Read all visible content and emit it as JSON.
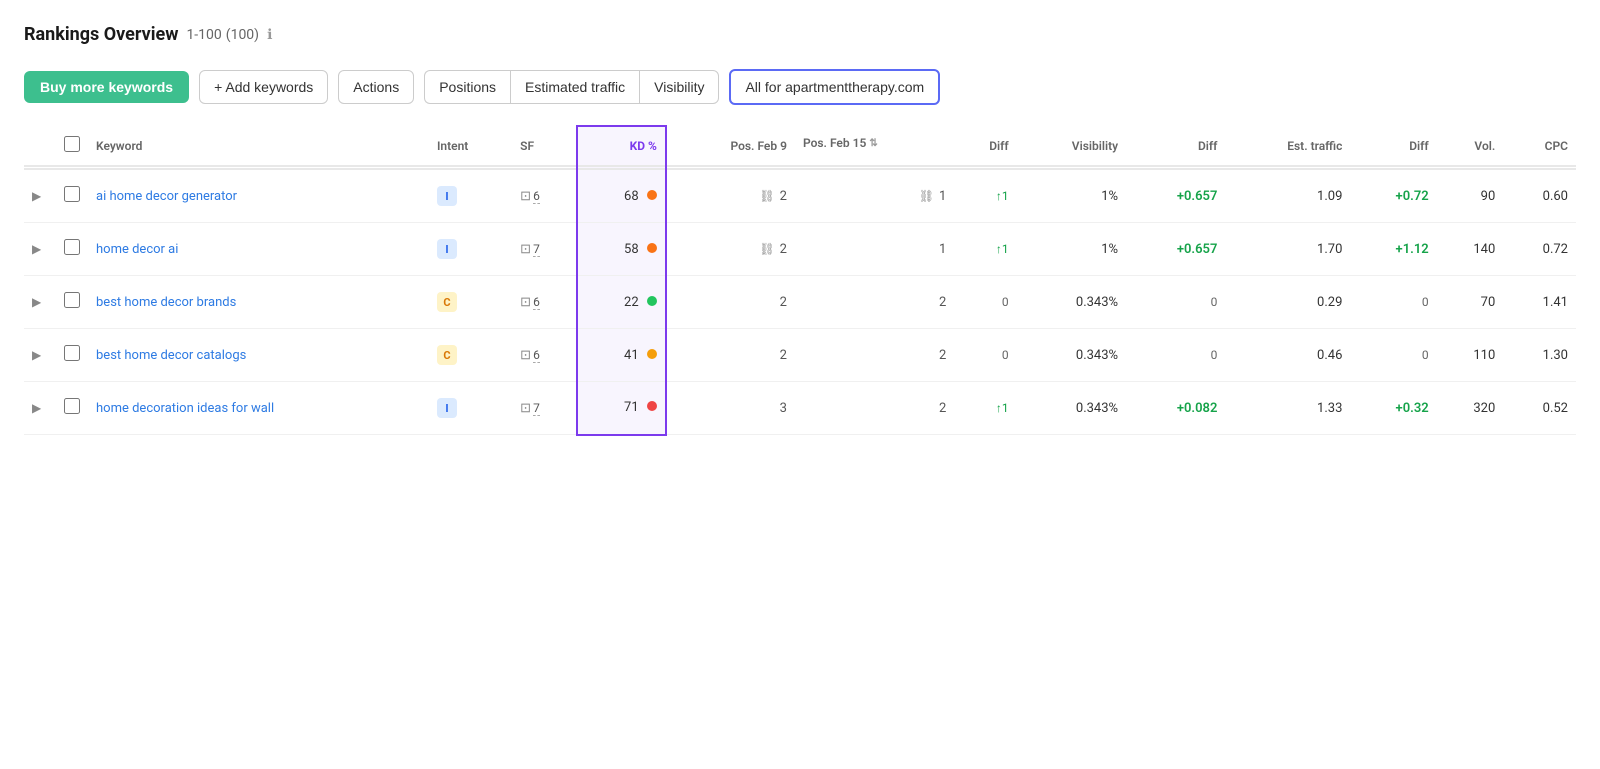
{
  "header": {
    "title": "Rankings Overview",
    "range": "1-100",
    "count": "(100)",
    "info_icon": "ℹ"
  },
  "toolbar": {
    "buy_keywords": "Buy more keywords",
    "add_keywords": "+ Add keywords",
    "actions": "Actions",
    "tabs": [
      "Positions",
      "Estimated traffic",
      "Visibility"
    ],
    "active_filter": "All for apartmenttherapy.com"
  },
  "columns": {
    "keyword": "Keyword",
    "intent": "Intent",
    "sf": "SF",
    "kd": "KD %",
    "pos_feb9": "Pos. Feb 9",
    "pos_feb15": "Pos. Feb 15",
    "diff": "Diff",
    "visibility": "Visibility",
    "vis_diff": "Diff",
    "est_traffic": "Est. traffic",
    "est_diff": "Diff",
    "vol": "Vol.",
    "cpc": "CPC"
  },
  "rows": [
    {
      "keyword": "ai home decor generator",
      "intent": "I",
      "intent_type": "i",
      "sf_num": "6",
      "kd": "68",
      "kd_dot": "orange",
      "pos_feb9": "2",
      "pos_feb9_chain": true,
      "pos_feb15": "1",
      "pos_feb15_chain": true,
      "diff": "+1",
      "diff_type": "up",
      "visibility": "1%",
      "vis_diff": "+0.657",
      "vis_diff_type": "pos",
      "est_traffic": "1.09",
      "est_diff": "+0.72",
      "est_diff_type": "pos",
      "vol": "90",
      "cpc": "0.60"
    },
    {
      "keyword": "home decor ai",
      "intent": "I",
      "intent_type": "i",
      "sf_num": "7",
      "kd": "58",
      "kd_dot": "orange",
      "pos_feb9": "2",
      "pos_feb9_chain": true,
      "pos_feb15": "1",
      "pos_feb15_chain": false,
      "diff": "+1",
      "diff_type": "up",
      "visibility": "1%",
      "vis_diff": "+0.657",
      "vis_diff_type": "pos",
      "est_traffic": "1.70",
      "est_diff": "+1.12",
      "est_diff_type": "pos",
      "vol": "140",
      "cpc": "0.72"
    },
    {
      "keyword": "best home decor brands",
      "intent": "C",
      "intent_type": "c",
      "sf_num": "6",
      "kd": "22",
      "kd_dot": "green",
      "pos_feb9": "2",
      "pos_feb9_chain": false,
      "pos_feb15": "2",
      "pos_feb15_chain": false,
      "diff": "0",
      "diff_type": "neutral",
      "visibility": "0.343%",
      "vis_diff": "0",
      "vis_diff_type": "neutral",
      "est_traffic": "0.29",
      "est_diff": "0",
      "est_diff_type": "neutral",
      "vol": "70",
      "cpc": "1.41"
    },
    {
      "keyword": "best home decor catalogs",
      "intent": "C",
      "intent_type": "c",
      "sf_num": "6",
      "kd": "41",
      "kd_dot": "yellow",
      "pos_feb9": "2",
      "pos_feb9_chain": false,
      "pos_feb15": "2",
      "pos_feb15_chain": false,
      "diff": "0",
      "diff_type": "neutral",
      "visibility": "0.343%",
      "vis_diff": "0",
      "vis_diff_type": "neutral",
      "est_traffic": "0.46",
      "est_diff": "0",
      "est_diff_type": "neutral",
      "vol": "110",
      "cpc": "1.30"
    },
    {
      "keyword": "home decoration ideas for wall",
      "intent": "I",
      "intent_type": "i",
      "sf_num": "7",
      "kd": "71",
      "kd_dot": "red",
      "pos_feb9": "3",
      "pos_feb9_chain": false,
      "pos_feb15": "2",
      "pos_feb15_chain": false,
      "diff": "+1",
      "diff_type": "up",
      "visibility": "0.343%",
      "vis_diff": "+0.082",
      "vis_diff_type": "pos",
      "est_traffic": "1.33",
      "est_diff": "+0.32",
      "est_diff_type": "pos",
      "vol": "320",
      "cpc": "0.52"
    }
  ]
}
